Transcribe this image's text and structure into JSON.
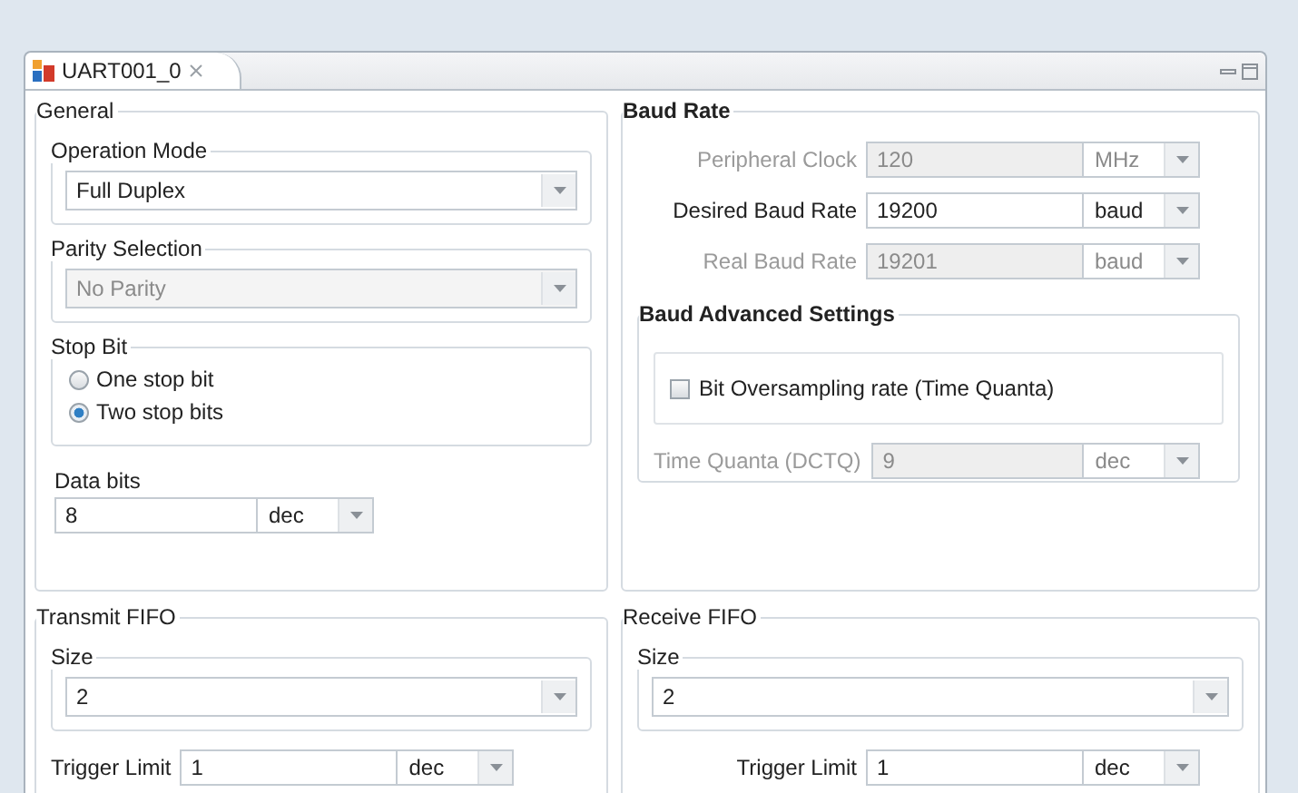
{
  "editor_tab": {
    "title": "UART001_0",
    "selected": true
  },
  "general": {
    "title": "General",
    "operation_mode": {
      "title": "Operation Mode",
      "value": "Full Duplex",
      "disabled": false
    },
    "parity": {
      "title": "Parity Selection",
      "value": "No Parity",
      "disabled": true
    },
    "stop_bit": {
      "title": "Stop Bit",
      "options": [
        {
          "label": "One stop bit",
          "selected": false
        },
        {
          "label": "Two stop bits",
          "selected": true
        }
      ]
    },
    "data_bits": {
      "label": "Data bits",
      "value": "8",
      "unit": "dec",
      "disabled": false
    }
  },
  "baud_rate": {
    "title": "Baud Rate",
    "rows": [
      {
        "label": "Peripheral Clock",
        "value": "120",
        "unit": "MHz",
        "disabled": true
      },
      {
        "label": "Desired Baud Rate",
        "value": "19200",
        "unit": "baud",
        "disabled": false
      },
      {
        "label": "Real Baud Rate",
        "value": "19201",
        "unit": "baud",
        "disabled": true
      }
    ],
    "advanced": {
      "title": "Baud Advanced Settings",
      "checkbox": {
        "label": "Bit Oversampling rate (Time Quanta)",
        "checked": false
      },
      "time_quanta": {
        "label": "Time Quanta (DCTQ)",
        "value": "9",
        "unit": "dec",
        "disabled": true
      }
    }
  },
  "transmit_fifo": {
    "title": "Transmit FIFO",
    "size": {
      "title": "Size",
      "value": "2",
      "disabled": false
    },
    "trigger": {
      "label": "Trigger Limit",
      "value": "1",
      "unit": "dec",
      "disabled": false
    }
  },
  "receive_fifo": {
    "title": "Receive FIFO",
    "size": {
      "title": "Size",
      "value": "2",
      "disabled": false
    },
    "trigger": {
      "label": "Trigger Limit",
      "value": "1",
      "unit": "dec",
      "disabled": false
    }
  }
}
